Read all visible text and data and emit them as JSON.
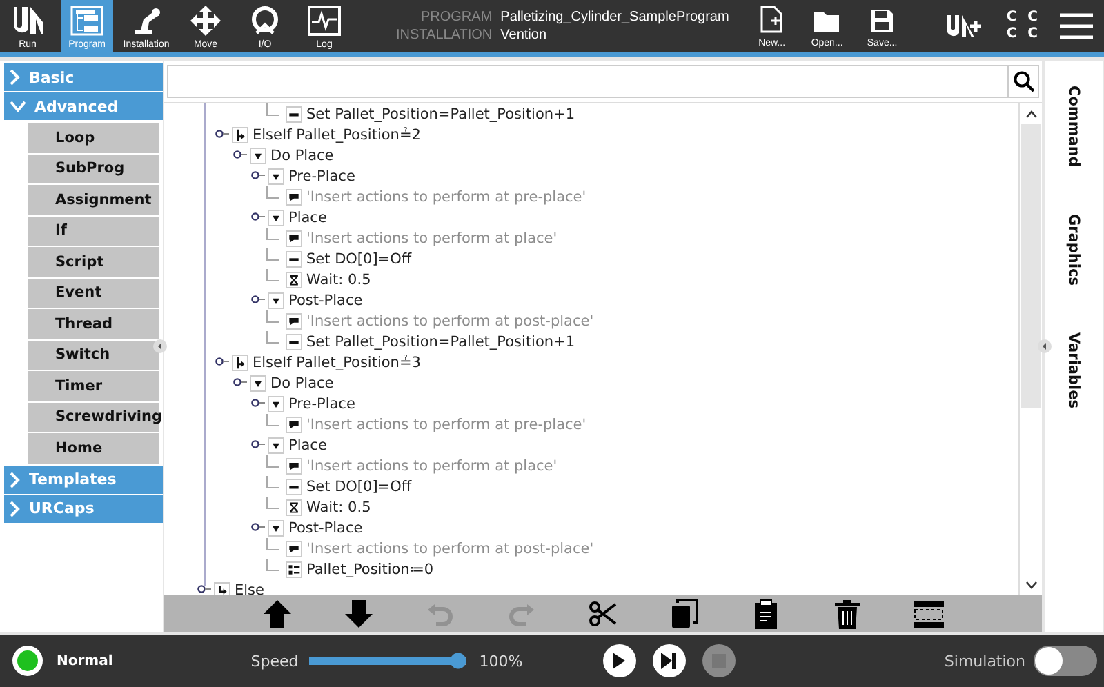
{
  "top_tabs": [
    {
      "label": "Run",
      "kind": "run",
      "selected": false
    },
    {
      "label": "Program",
      "kind": "program",
      "selected": true
    },
    {
      "label": "Installation",
      "kind": "installation",
      "selected": false
    },
    {
      "label": "Move",
      "kind": "move",
      "selected": false
    },
    {
      "label": "I/O",
      "kind": "io",
      "selected": false
    },
    {
      "label": "Log",
      "kind": "log",
      "selected": false
    }
  ],
  "header": {
    "program_label": "PROGRAM",
    "program": "Palletizing_Cylinder_SampleProgram",
    "installation_label": "INSTALLATION",
    "installation": "Vention"
  },
  "file_buttons": [
    {
      "label": "New...",
      "kind": "new"
    },
    {
      "label": "Open...",
      "kind": "open"
    },
    {
      "label": "Save...",
      "kind": "save"
    }
  ],
  "status_letters": [
    "C",
    "C",
    "C",
    "C"
  ],
  "sidebar": [
    {
      "label": "Basic",
      "expanded": false
    },
    {
      "label": "Advanced",
      "expanded": true,
      "children": [
        "Loop",
        "SubProg",
        "Assignment",
        "If",
        "Script",
        "Event",
        "Thread",
        "Switch",
        "Timer",
        "Screwdriving",
        "Home"
      ]
    },
    {
      "label": "Templates",
      "expanded": false
    },
    {
      "label": "URCaps",
      "expanded": false
    }
  ],
  "scrolled_rows": [
    {
      "kind": "set",
      "text": "Set Pallet_Position=Pallet_Position+1"
    }
  ],
  "tree": [
    {
      "kind": "elseif",
      "text": "ElseIf Pallet_Position≟2",
      "children": [
        {
          "kind": "folder",
          "text": "Do Place",
          "expanded": true,
          "children": [
            {
              "kind": "folder",
              "text": "Pre-Place",
              "expanded": true,
              "children": [
                {
                  "kind": "comment",
                  "text": "'Insert actions to perform at pre-place'"
                }
              ]
            },
            {
              "kind": "folder",
              "text": "Place",
              "expanded": true,
              "children": [
                {
                  "kind": "comment",
                  "text": "'Insert actions to perform at place'"
                },
                {
                  "kind": "set",
                  "text": "Set DO[0]=Off"
                },
                {
                  "kind": "wait",
                  "text": "Wait: 0.5"
                }
              ]
            },
            {
              "kind": "folder",
              "text": "Post-Place",
              "expanded": true,
              "children": [
                {
                  "kind": "comment",
                  "text": "'Insert actions to perform at post-place'"
                },
                {
                  "kind": "set",
                  "text": "Set Pallet_Position=Pallet_Position+1"
                }
              ]
            }
          ]
        }
      ]
    },
    {
      "kind": "elseif",
      "text": "ElseIf Pallet_Position≟3",
      "children": [
        {
          "kind": "folder",
          "text": "Do Place",
          "expanded": true,
          "children": [
            {
              "kind": "folder",
              "text": "Pre-Place",
              "expanded": true,
              "children": [
                {
                  "kind": "comment",
                  "text": "'Insert actions to perform at pre-place'"
                }
              ]
            },
            {
              "kind": "folder",
              "text": "Place",
              "expanded": true,
              "children": [
                {
                  "kind": "comment",
                  "text": "'Insert actions to perform at place'"
                },
                {
                  "kind": "set",
                  "text": "Set DO[0]=Off"
                },
                {
                  "kind": "wait",
                  "text": "Wait: 0.5"
                }
              ]
            },
            {
              "kind": "folder",
              "text": "Post-Place",
              "expanded": true,
              "children": [
                {
                  "kind": "comment",
                  "text": "'Insert actions to perform at post-place'"
                },
                {
                  "kind": "assign",
                  "text": "Pallet_Position≔0"
                }
              ]
            }
          ]
        }
      ]
    },
    {
      "kind": "else",
      "text": "Else"
    }
  ],
  "toolbar": [
    {
      "kind": "up",
      "disabled": false
    },
    {
      "kind": "down",
      "disabled": false
    },
    {
      "kind": "undo",
      "disabled": true
    },
    {
      "kind": "redo",
      "disabled": true
    },
    {
      "kind": "cut",
      "disabled": false
    },
    {
      "kind": "copy",
      "disabled": false
    },
    {
      "kind": "paste",
      "disabled": false
    },
    {
      "kind": "delete",
      "disabled": false
    },
    {
      "kind": "suppress",
      "disabled": false
    }
  ],
  "right_tabs": [
    "Command",
    "Graphics",
    "Variables"
  ],
  "footer": {
    "status": "Normal",
    "speed_label": "Speed",
    "speed": {
      "level": 1.0
    },
    "speed_reading": "100%",
    "controls": [
      {
        "kind": "play",
        "disabled": false
      },
      {
        "kind": "step",
        "disabled": false
      },
      {
        "kind": "stop",
        "disabled": true
      }
    ],
    "simulation_label": "Simulation",
    "simulation": {
      "on": false
    }
  }
}
